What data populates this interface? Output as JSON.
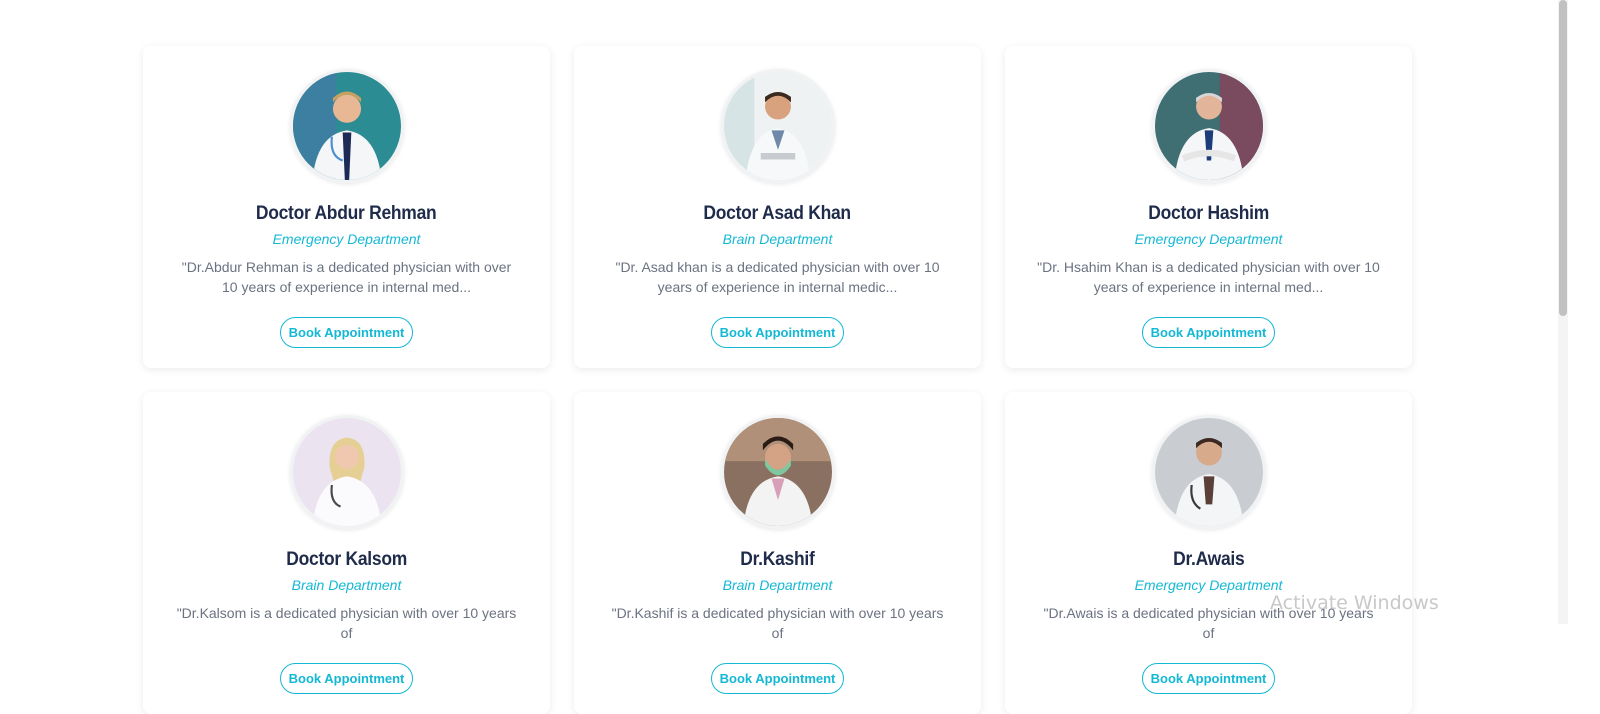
{
  "doctors": [
    {
      "name": "Doctor Abdur Rehman",
      "department": "Emergency Department",
      "bio": "\"Dr.Abdur Rehman is a dedicated physician with over 10 years of experience in internal med...",
      "button": "Book Appointment"
    },
    {
      "name": "Doctor Asad Khan",
      "department": "Brain Department",
      "bio": "\"Dr. Asad khan is a dedicated physician with over 10 years of experience in internal medic...",
      "button": "Book Appointment"
    },
    {
      "name": "Doctor Hashim",
      "department": "Emergency Department",
      "bio": "\"Dr. Hsahim Khan is a dedicated physician with over 10 years of experience in internal med...",
      "button": "Book Appointment"
    },
    {
      "name": "Doctor Kalsom",
      "department": "Brain Department",
      "bio": "\"Dr.Kalsom is a dedicated physician with over 10 years of",
      "button": "Book Appointment"
    },
    {
      "name": "Dr.Kashif",
      "department": "Brain Department",
      "bio": "\"Dr.Kashif is a dedicated physician with over 10 years of",
      "button": "Book Appointment"
    },
    {
      "name": "Dr.Awais",
      "department": "Emergency Department",
      "bio": "\"Dr.Awais is a dedicated physician with over 10 years of",
      "button": "Book Appointment"
    }
  ],
  "watermark": "Activate Windows",
  "colors": {
    "accent": "#14b8d4",
    "name": "#1f2b4a",
    "bio": "#6b7280"
  },
  "icons": {
    "avatar": "doctor-photo"
  }
}
